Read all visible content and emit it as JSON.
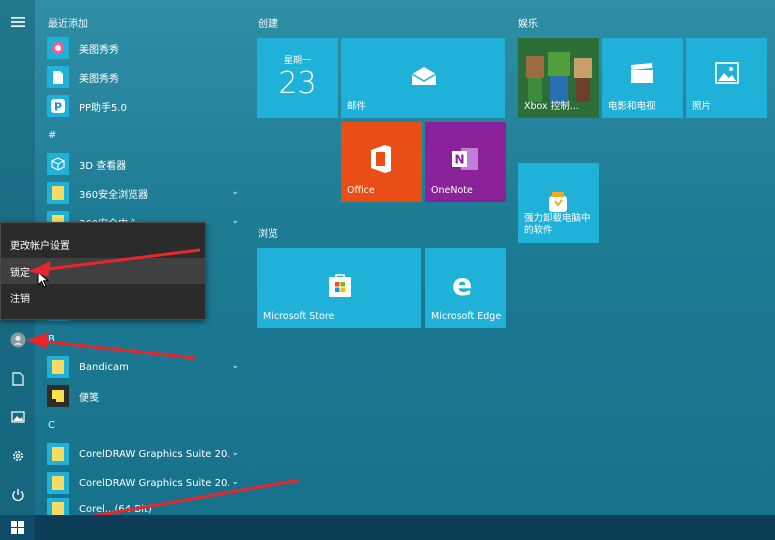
{
  "colors": {
    "accent": "#1fb1d8",
    "office": "#ea4e17",
    "onenote": "#8a2399",
    "xbox": "#107c10",
    "arrow": "#e8262b",
    "menu_bg": "#2b2b2b"
  },
  "sidebar": {
    "icons": [
      "hamburger-icon",
      "user-avatar-icon",
      "document-icon",
      "pictures-icon",
      "settings-icon",
      "power-icon"
    ]
  },
  "applist": {
    "recent_header": "最近添加",
    "items": [
      {
        "label": "美图秀秀",
        "icon": "meitu-icon"
      },
      {
        "label": "美图秀秀",
        "icon": "file-icon"
      },
      {
        "label": "PP助手5.0",
        "icon": "pp-icon"
      }
    ],
    "hash_header": "#",
    "hash_items": [
      {
        "label": "3D 查看器",
        "icon": "cube-icon"
      },
      {
        "label": "360安全浏览器",
        "icon": "folder-icon"
      },
      {
        "label": "360安全中心",
        "icon": "folder-icon"
      }
    ],
    "b_header": "B",
    "b_items": [
      {
        "label": "Bandicam",
        "icon": "folder-icon"
      },
      {
        "label": "便笺",
        "icon": "sticky-icon"
      }
    ],
    "c_header": "C",
    "c_items": [
      {
        "label": "CorelDRAW Graphics Suite 20...",
        "icon": "folder-icon"
      },
      {
        "label": "CorelDRAW Graphics Suite 20...",
        "icon": "folder-icon"
      },
      {
        "label": "Corel...(64-Bit)",
        "icon": "folder-icon"
      }
    ]
  },
  "context_menu": {
    "items": [
      "更改帐户设置",
      "锁定",
      "注销"
    ]
  },
  "groups": {
    "create": "创建",
    "browse": "浏览",
    "entertainment": "娱乐"
  },
  "tiles": {
    "calendar_day": "星期一",
    "calendar_date": "23",
    "mail": "邮件",
    "office": "Office",
    "onenote": "OneNote",
    "store": "Microsoft Store",
    "edge": "Microsoft Edge",
    "xbox": "Xbox 控制...",
    "movies": "电影和电视",
    "photos": "照片",
    "uninstall": "强力卸载电脑中\n的软件"
  }
}
